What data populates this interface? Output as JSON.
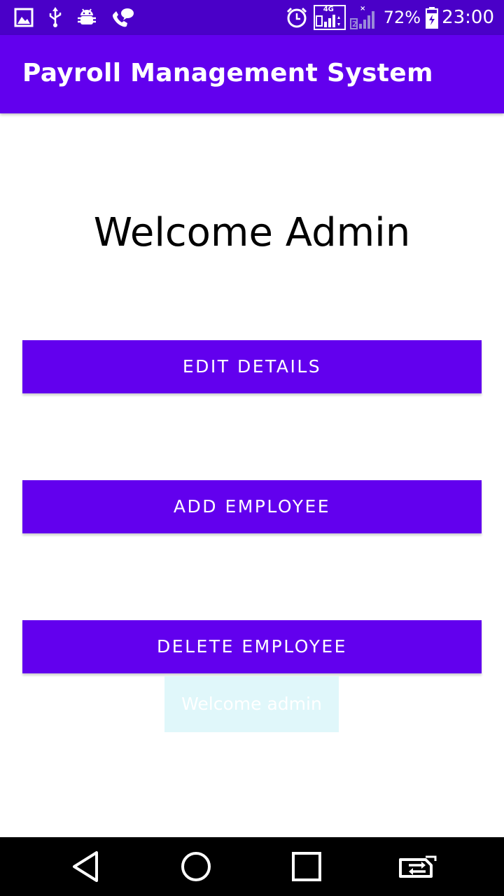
{
  "status_bar": {
    "left_icons": [
      "gallery-icon",
      "usb-icon",
      "android-debug-icon",
      "call-chat-icon"
    ],
    "network_label": "4G",
    "sim2_label": "2",
    "battery_percent": "72%",
    "time": "23:00"
  },
  "app_bar": {
    "title": "Payroll Management System"
  },
  "main": {
    "welcome_heading": "Welcome Admin",
    "buttons": [
      {
        "label": "EDIT DETAILS"
      },
      {
        "label": "ADD EMPLOYEE"
      },
      {
        "label": "DELETE EMPLOYEE"
      }
    ],
    "toast": "Welcome admin"
  },
  "nav_bar": {
    "icons": [
      "back-icon",
      "home-icon",
      "recents-icon",
      "switch-sim-icon"
    ]
  },
  "colors": {
    "status_bar": "#4a00c8",
    "primary": "#6200ee",
    "toast_bg": "#e0f7fa",
    "nav_bar": "#000000"
  }
}
